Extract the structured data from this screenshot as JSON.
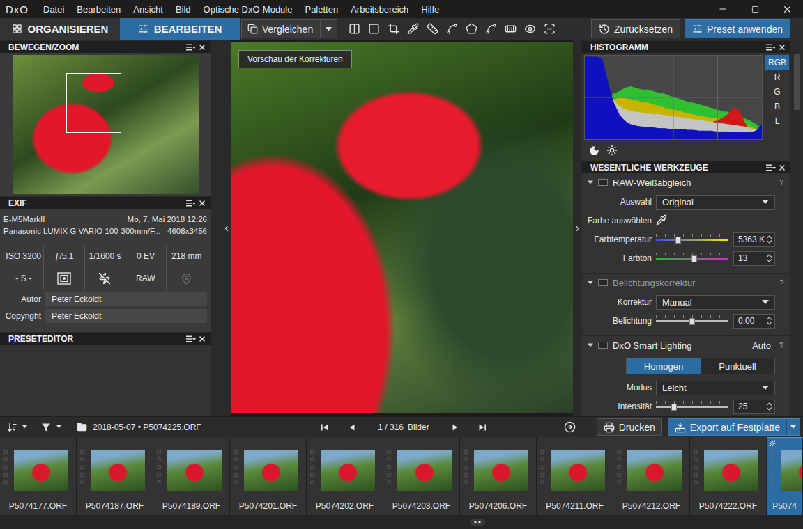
{
  "app": {
    "logo": "DxO"
  },
  "menu": [
    "Datei",
    "Bearbeiten",
    "Ansicht",
    "Bild",
    "Optische DxO-Module",
    "Paletten",
    "Arbeitsbereich",
    "Hilfe"
  ],
  "tabs": [
    {
      "label": "ORGANISIEREN",
      "selected": false
    },
    {
      "label": "BEARBEITEN",
      "selected": true
    }
  ],
  "compare": {
    "label": "Vergleichen"
  },
  "actions": {
    "reset": "Zurücksetzen",
    "apply_preset": "Preset anwenden"
  },
  "viewer": {
    "tooltip": "Vorschau der Korrekturen"
  },
  "navigator": {
    "title": "BEWEGEN/ZOOM"
  },
  "exif": {
    "title": "EXIF",
    "camera": "E-M5MarkII",
    "date": "Mo, 7. Mai 2018 12:26",
    "lens": "Panasonic LUMIX G VARIO 100-300mm/F...",
    "size": "4608x3456",
    "settings": [
      "ISO 3200",
      "ƒ/5.1",
      "1/1600 s",
      "0 EV",
      "218 mm"
    ],
    "exposure_mode": "- S -",
    "format": "RAW",
    "gps_available": false,
    "fields": [
      {
        "label": "Autor",
        "value": "Peter Eckoldt"
      },
      {
        "label": "Copyright",
        "value": "Peter Eckoldt"
      }
    ]
  },
  "preset_editor": {
    "title": "PRESETEDITOR"
  },
  "histogram": {
    "title": "HISTOGRAMM",
    "channels": [
      {
        "label": "RGB",
        "selected": true
      },
      {
        "label": "R",
        "selected": false
      },
      {
        "label": "G",
        "selected": false
      },
      {
        "label": "B",
        "selected": false
      },
      {
        "label": "L",
        "selected": false
      }
    ],
    "series": [
      {
        "color": "#2fc02f",
        "values": [
          5,
          15,
          40,
          55,
          50,
          55,
          58,
          62,
          64,
          62,
          60,
          60,
          58,
          56,
          55,
          52,
          50,
          48,
          45,
          44,
          42,
          40,
          38,
          36,
          34,
          33,
          30,
          28,
          25,
          22,
          18,
          12
        ]
      },
      {
        "color": "#c8b400",
        "values": [
          5,
          12,
          30,
          42,
          45,
          48,
          50,
          50,
          48,
          47,
          45,
          44,
          42,
          40,
          38,
          36,
          35,
          33,
          31,
          30,
          28,
          27,
          26,
          25,
          24,
          23,
          22,
          20,
          18,
          15,
          12,
          8
        ]
      },
      {
        "color": "#d01818",
        "values": [
          0,
          5,
          20,
          35,
          38,
          40,
          38,
          35,
          30,
          28,
          25,
          24,
          22,
          20,
          19,
          18,
          18,
          17,
          17,
          18,
          18,
          19,
          20,
          22,
          25,
          30,
          38,
          35,
          20,
          10,
          6,
          4
        ]
      },
      {
        "color": "#c4c4c4",
        "values": [
          20,
          70,
          95,
          85,
          62,
          48,
          40,
          36,
          34,
          33,
          32,
          31,
          30,
          30,
          29,
          28,
          27,
          26,
          25,
          24,
          23,
          22,
          21,
          20,
          19,
          18,
          17,
          16,
          15,
          13,
          11,
          9
        ]
      },
      {
        "color": "#1010c0",
        "values": [
          100,
          100,
          100,
          98,
          70,
          45,
          30,
          22,
          18,
          16,
          15,
          14,
          14,
          13,
          13,
          12,
          12,
          12,
          11,
          11,
          10,
          10,
          10,
          9,
          9,
          9,
          8,
          8,
          8,
          8,
          10,
          18
        ]
      }
    ]
  },
  "tools": {
    "title": "WESENTLICHE WERKZEUGE",
    "sections": [
      {
        "title": "RAW-Weißabgleich",
        "expanded": true,
        "checked": false,
        "disabled": false,
        "badge": "",
        "help": "?",
        "rows": [
          {
            "kind": "dropdown",
            "label": "Auswahl",
            "value": "Original"
          },
          {
            "kind": "picker",
            "label": "Farbe auswählen"
          },
          {
            "kind": "slider",
            "label": "Farbtemperatur",
            "level": 0.31,
            "reading": "5363 K",
            "colors": [
              "#3048ff",
              "#f0f000"
            ]
          },
          {
            "kind": "slider",
            "label": "Farbton",
            "level": 0.53,
            "reading": "13",
            "colors": [
              "#20c020",
              "#e020e0"
            ]
          }
        ]
      },
      {
        "title": "Belichtungskorrektur",
        "expanded": true,
        "checked": false,
        "disabled": true,
        "badge": "",
        "help": "?",
        "rows": [
          {
            "kind": "dropdown",
            "label": "Korrektur",
            "value": "Manual"
          },
          {
            "kind": "slider",
            "label": "Belichtung",
            "level": 0.5,
            "reading": "0.00",
            "colors": [
              "#bdbdbd",
              "#bdbdbd"
            ]
          }
        ]
      },
      {
        "title": "DxO Smart Lighting",
        "expanded": true,
        "checked": false,
        "disabled": false,
        "badge": "Auto",
        "help": "?",
        "rows": [
          {
            "kind": "segmented",
            "options": [
              {
                "label": "Homogen",
                "selected": true
              },
              {
                "label": "Punktuell",
                "selected": false
              }
            ]
          },
          {
            "kind": "dropdown",
            "label": "Modus",
            "value": "Leicht"
          },
          {
            "kind": "slider",
            "label": "Intensität",
            "level": 0.25,
            "reading": "25",
            "colors": [
              "#bdbdbd",
              "#bdbdbd"
            ]
          }
        ]
      }
    ]
  },
  "browser": {
    "folder": "2018-05-07",
    "separator": "•",
    "file": "P5074225.ORF",
    "position": "1 / 316",
    "unit": "Bilder",
    "print": "Drucken",
    "export": "Export auf Festplatte"
  },
  "filmstrip": [
    {
      "name": "P5074177.ORF",
      "stars": 0,
      "selected": false
    },
    {
      "name": "P5074187.ORF",
      "stars": 0,
      "selected": false
    },
    {
      "name": "P5074189.ORF",
      "stars": 0,
      "selected": false
    },
    {
      "name": "P5074201.ORF",
      "stars": 0,
      "selected": false
    },
    {
      "name": "P5074202.ORF",
      "stars": 0,
      "selected": false
    },
    {
      "name": "P5074203.ORF",
      "stars": 0,
      "selected": false
    },
    {
      "name": "P5074206.ORF",
      "stars": 0,
      "selected": false
    },
    {
      "name": "P5074211.ORF",
      "stars": 0,
      "selected": false
    },
    {
      "name": "P5074212.ORF",
      "stars": 0,
      "selected": false
    },
    {
      "name": "P5074222.ORF",
      "stars": 0,
      "selected": false
    },
    {
      "name": "P5074",
      "stars": 0,
      "selected": true
    }
  ]
}
